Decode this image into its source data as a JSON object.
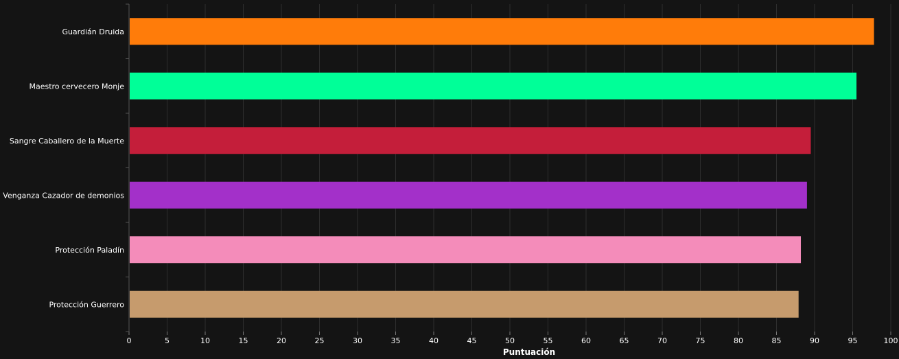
{
  "chart_data": {
    "type": "bar",
    "orientation": "horizontal",
    "categories": [
      "Guardián Druida",
      "Maestro cervecero Monje",
      "Sangre Caballero de la Muerte",
      "Venganza Cazador de demonios",
      "Protección Paladín",
      "Protección Guerrero"
    ],
    "values": [
      97.8,
      95.5,
      89.5,
      89.0,
      88.2,
      87.9
    ],
    "colors": [
      "#ff7c0a",
      "#00ff98",
      "#c41e3a",
      "#a330c9",
      "#f48cba",
      "#c69b6d"
    ],
    "xlabel": "Puntuación",
    "ylabel": "",
    "xlim": [
      0,
      100
    ],
    "xticks": [
      0,
      5,
      10,
      15,
      20,
      25,
      30,
      35,
      40,
      45,
      50,
      55,
      60,
      65,
      70,
      75,
      80,
      85,
      90,
      95,
      100
    ],
    "grid": true,
    "background": "#141414",
    "text_color": "#ffffff",
    "grid_color": "#2e2e2e"
  }
}
